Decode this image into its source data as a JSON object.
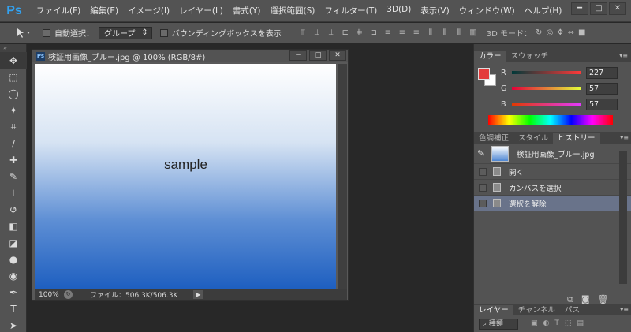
{
  "app": {
    "logo": "Ps"
  },
  "menu": [
    "ファイル(F)",
    "編集(E)",
    "イメージ(I)",
    "レイヤー(L)",
    "書式(Y)",
    "選択範囲(S)",
    "フィルター(T)",
    "3D(D)",
    "表示(V)",
    "ウィンドウ(W)",
    "ヘルプ(H)"
  ],
  "window_controls": {
    "minimize": "━",
    "maximize": "□",
    "close": "✕"
  },
  "options": {
    "auto_select_label": "自動選択：",
    "auto_select_value": "グループ",
    "bounding_box_label": "バウンディングボックスを表示",
    "mode_3d_label": "3D モード："
  },
  "document": {
    "title": "検証用画像_ブルー.jpg @ 100% (RGB/8#)",
    "canvas_text": "sample",
    "zoom": "100%",
    "file_info": "ファイル：506.3K/506.3K"
  },
  "color_panel": {
    "tabs": [
      "カラー",
      "スウォッチ"
    ],
    "fg_color": "#e33939",
    "r_label": "R",
    "r_value": "227",
    "g_label": "G",
    "g_value": "57",
    "b_label": "B",
    "b_value": "57"
  },
  "history_panel": {
    "tabs": [
      "色調補正",
      "スタイル",
      "ヒストリー"
    ],
    "snapshot": "検証用画像_ブルー.jpg",
    "items": [
      "開く",
      "カンバスを選択",
      "選択を解除"
    ]
  },
  "layers_panel": {
    "tabs": [
      "レイヤー",
      "チャンネル",
      "パス"
    ],
    "filter_label": "種類"
  }
}
